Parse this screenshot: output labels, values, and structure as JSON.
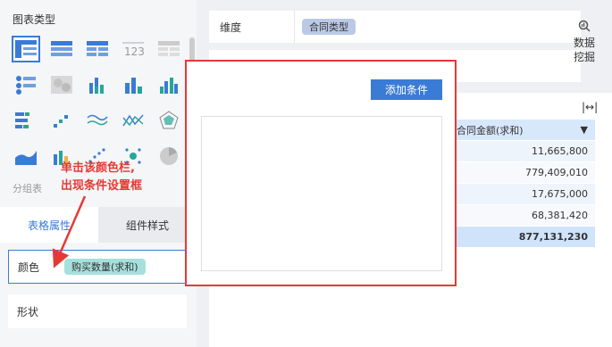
{
  "left": {
    "chart_type_title": "图表类型",
    "group_label": "分组表",
    "tabs": {
      "table_props": "表格属性",
      "component_style": "组件样式"
    },
    "color_field": {
      "label": "颜色",
      "value": "购买数量(求和)"
    },
    "shape_field": {
      "label": "形状"
    }
  },
  "chart_icons": [
    "cross-table-icon",
    "row-table-icon",
    "detail-table-icon",
    "kpi-number-icon",
    "grid-table-icon",
    "legend-icon",
    "heat-map-icon",
    "stacked-bar-icon",
    "bar-chart-icon",
    "grouped-bar-icon",
    "horizontal-bar-icon",
    "scatter-step-icon",
    "multi-line-icon",
    "line-compare-icon",
    "radar-icon",
    "area-chart-icon",
    "combo-chart-icon",
    "scatter-icon",
    "bubble-icon",
    "pie-chart-icon"
  ],
  "dimension": {
    "label": "维度",
    "value": "合同类型"
  },
  "side_button": {
    "line1": "数据",
    "line2": "挖掘"
  },
  "expand_symbol": "|↔|",
  "table": {
    "header": "合同金额(求和)",
    "sort_symbol": "▼",
    "rows": [
      "11,665,800",
      "779,409,010",
      "17,675,000",
      "68,381,420"
    ],
    "total": "877,131,230"
  },
  "popup": {
    "add_button": "添加条件"
  },
  "annotation": {
    "line1": "单击该颜色栏,",
    "line2": "出现条件设置框"
  },
  "colors": {
    "accent": "#3a7bd5",
    "highlight": "#e53935",
    "teal_pill": "#a6e0dc",
    "blue_pill": "#bcc9e6"
  }
}
